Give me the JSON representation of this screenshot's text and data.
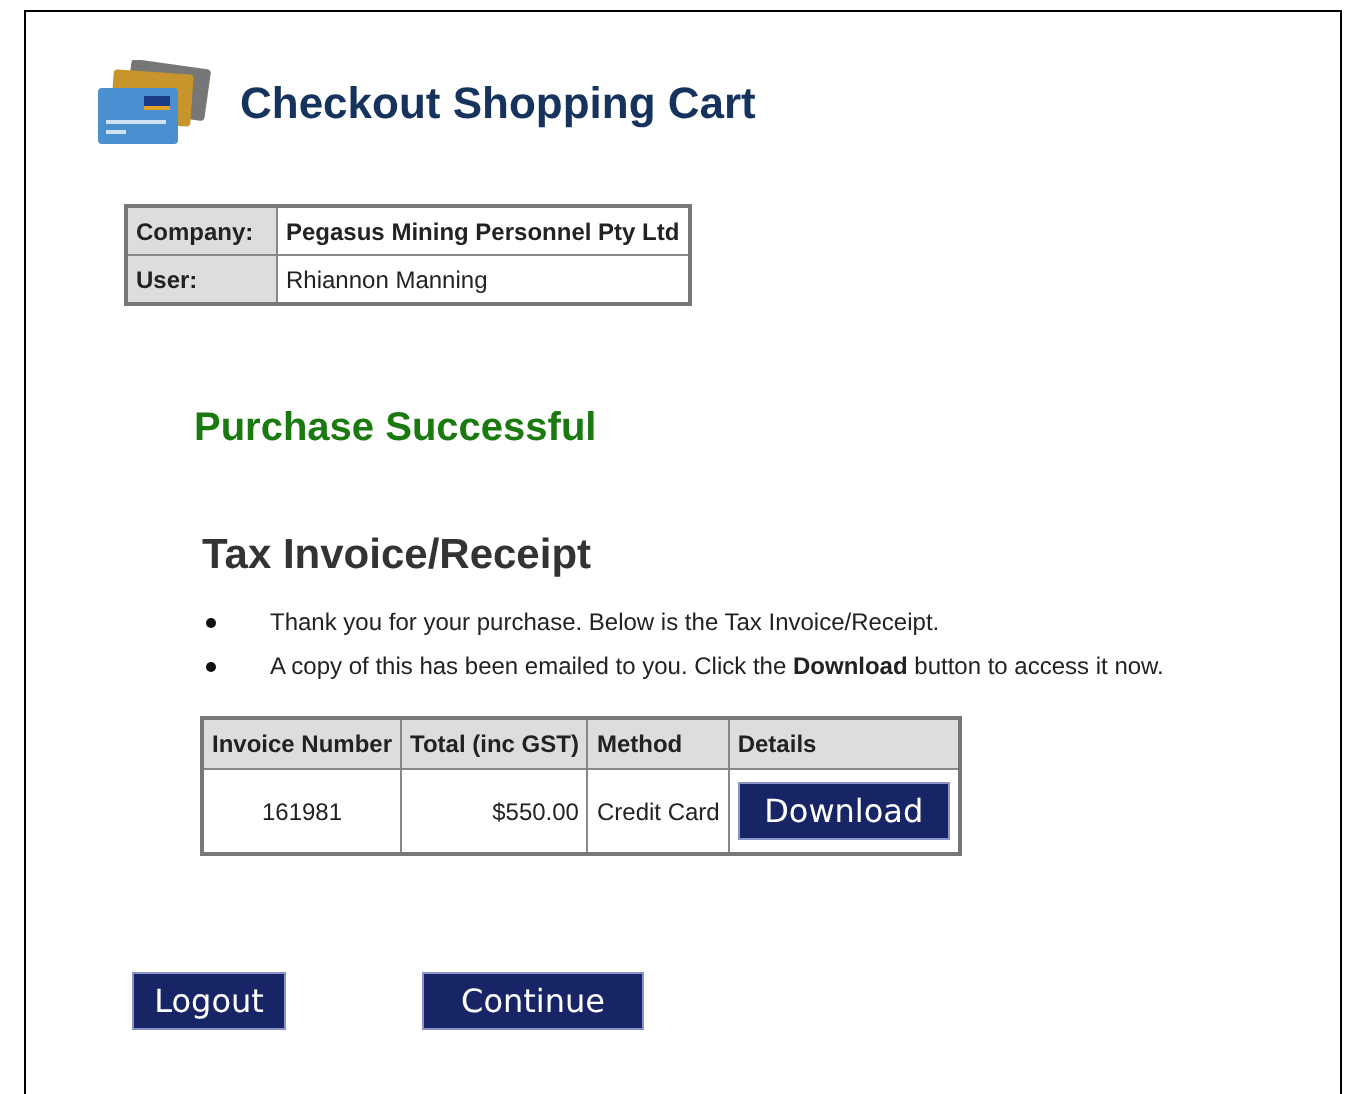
{
  "header": {
    "title": "Checkout Shopping Cart"
  },
  "account": [
    {
      "label": "Company:",
      "value": "Pegasus Mining Personnel Pty Ltd"
    },
    {
      "label": "User:",
      "value": "Rhiannon Manning"
    }
  ],
  "status": "Purchase Successful",
  "receipt": {
    "heading": "Tax Invoice/Receipt",
    "notes": [
      "Thank you for your purchase. Below is the Tax Invoice/Receipt.",
      "A copy of this has been emailed to you. Click the **Download** button to access it now."
    ],
    "table": {
      "columns": [
        "Invoice Number",
        "Total (inc GST)",
        "Method",
        "Details"
      ],
      "rows": [
        {
          "invoice": "161981",
          "total": "$550.00",
          "method": "Credit Card",
          "action": "Download"
        }
      ]
    }
  },
  "buttons": [
    "Logout",
    "Continue"
  ]
}
